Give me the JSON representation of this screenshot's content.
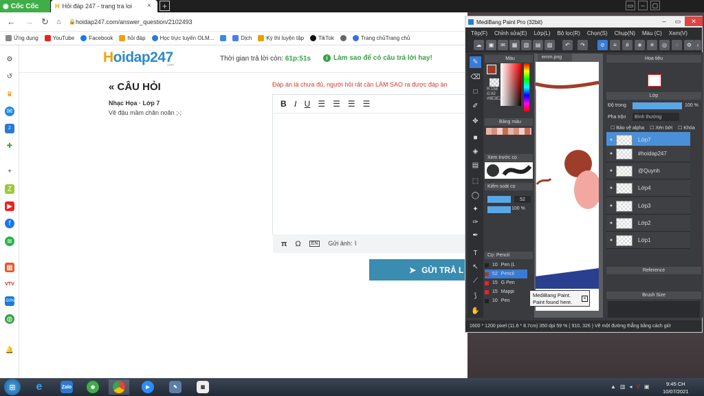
{
  "browser": {
    "brand": "Cốc Cốc",
    "tab_title": "Hỏi đáp 247 - trang tra loi",
    "tab_close": "×",
    "new_tab": "+",
    "url": "hoidap247.com/answer_question/2102493",
    "bookmarks": [
      "Ứng dụng",
      "YouTube",
      "Facebook",
      "hỏi đáp",
      "Học trực tuyến OLM...",
      "",
      "Dịch",
      "Kỳ thi luyện tập",
      "TikTok",
      "",
      "Trang chủTrang chủ"
    ]
  },
  "site": {
    "logo_main": "oidap247",
    "logo_h": "H",
    "logo_sub": ".com",
    "timer_label": "Thời gian trả lời còn: ",
    "timer_value": "61p:51s",
    "howto": "Làm sao để có câu trả lời hay!",
    "question_title": "« CÂU HỎI",
    "subject": "Nhạc Họa · Lớp 7",
    "question_text": "Vẽ đậu mầm chăn noãn ;-;",
    "notice": "Đáp án là chưa đủ, người hỏi rất cần LÀM SAO ra được đáp án",
    "attach_label": "Gửi ảnh:",
    "submit_label": "GỬI TRẢ L"
  },
  "medibang": {
    "title": "MediBang Paint Pro (32bit)",
    "menu": [
      "Tệp(F)",
      "Chỉnh sửa(E)",
      "Lớp(L)",
      "Bộ lọc(R)",
      "Chọn(S)",
      "Chụp(N)",
      "Màu (C)",
      "Xem(V)"
    ],
    "panels": {
      "color": "Màu",
      "palette": "Bảng màu",
      "preview": "Xem trước cọ",
      "brush_control": "Kiểm soát cọ",
      "brush": "Cọ: Pencil"
    },
    "color_values": {
      "r": "R:158",
      "g": "G:62",
      "hex": "#9E3E2A"
    },
    "brush_size": "52",
    "opacity_pct": "100 %",
    "brushes": [
      {
        "size": "10",
        "name": "Pen (L"
      },
      {
        "size": "52",
        "name": "Pencil"
      },
      {
        "size": "15",
        "name": "G Pen"
      },
      {
        "size": "15",
        "name": "Mappi"
      },
      {
        "size": "10",
        "name": "Pen"
      }
    ],
    "canvas_tab": "emm.png",
    "right_panels": {
      "hoa_tieu": "Hoa tiêu",
      "lop": "Lớp",
      "reference": "Reference",
      "brush_size": "Brush Size"
    },
    "layer_opts": {
      "opacity_label": "Độ trong",
      "opacity_value": "100 %",
      "blend_label": "Pha trộn",
      "blend_value": "Bình thường",
      "protect_alpha": "Bảo vệ alpha",
      "clip": "Xén bớt",
      "lock": "Khóa"
    },
    "layers": [
      "Lớp7",
      "#hoidap247",
      "@Quynh",
      "Lớp4",
      "Lớp3",
      "Lớp2",
      "Lớp1"
    ],
    "status": "1600 * 1200 pixel  (11.6 * 8.7cm)  350 dpi  59 %  ( 910, 326 )  Vẽ một đường thẳng bằng cách giữ",
    "tooltip_line1": "MediBang Paint.",
    "tooltip_line2": "Paint found here."
  },
  "taskbar": {
    "time": "9:45 CH",
    "date": "10/07/2021"
  },
  "colors": {
    "green": "#3aa046",
    "blue": "#3a8cb1",
    "red": "#d23a2d",
    "swatch": "#9E3E2A"
  }
}
